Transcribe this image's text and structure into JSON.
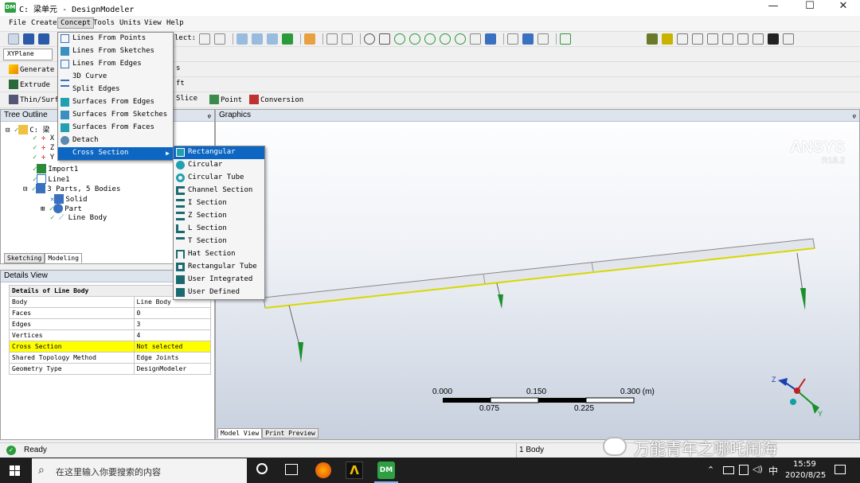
{
  "window": {
    "title": "C: 梁单元 - DesignModeler",
    "minimize": "—",
    "maximize": "☐",
    "close": "✕"
  },
  "menubar": [
    "File",
    "Create",
    "Concept",
    "Tools",
    "Units",
    "View",
    "Help"
  ],
  "toolbar": {
    "select_label": "lect:",
    "plane": "XYPlane",
    "generate": "Generate",
    "extrude": "Extrude",
    "thin": "Thin/Surfa",
    "slice": "Slice",
    "point": "Point",
    "conversion": "Conversion",
    "fragment_s": "s",
    "fragment_ft": "ft"
  },
  "concept_menu": [
    "Lines From Points",
    "Lines From Sketches",
    "Lines From Edges",
    "3D Curve",
    "Split Edges",
    "Surfaces From Edges",
    "Surfaces From Sketches",
    "Surfaces From Faces",
    "Detach",
    "Cross Section"
  ],
  "cross_section_menu": [
    "Rectangular",
    "Circular",
    "Circular Tube",
    "Channel Section",
    "I Section",
    "Z Section",
    "L Section",
    "T Section",
    "Hat Section",
    "Rectangular Tube",
    "User Integrated",
    "User Defined"
  ],
  "tree": {
    "header": "Tree Outline",
    "pin": "ᵩ",
    "root": "C: 梁",
    "nodes": [
      "X",
      "Z",
      "Y",
      "Import1",
      "Line1",
      "3 Parts, 5 Bodies",
      "Solid",
      "Part",
      "Line Body"
    ],
    "tabs": [
      "Sketching",
      "Modeling"
    ]
  },
  "details": {
    "header": "Details View",
    "title": "Details of Line Body",
    "rows": [
      [
        "Body",
        "Line Body"
      ],
      [
        "Faces",
        "0"
      ],
      [
        "Edges",
        "3"
      ],
      [
        "Vertices",
        "4"
      ],
      [
        "Cross Section",
        "Not selected"
      ],
      [
        "Shared Topology Method",
        "Edge Joints"
      ],
      [
        "Geometry Type",
        "DesignModeler"
      ]
    ]
  },
  "graphics": {
    "header": "Graphics",
    "brand": "ANSYS",
    "version": "R18.2",
    "scale_top": [
      "0.000",
      "0.150",
      "0.300 (m)"
    ],
    "scale_bottom": [
      "0.075",
      "0.225"
    ],
    "axis_z": "Z",
    "axis_y": "Y",
    "tabs": [
      "Model View",
      "Print Preview"
    ]
  },
  "status": {
    "ready": "Ready",
    "bodies": "1 Body",
    "watermark": "万能青年之哪吒闹海"
  },
  "taskbar": {
    "search_placeholder": "在这里输入你要搜索的内容",
    "ime": "中",
    "time": "15:59",
    "date": "2020/8/25"
  },
  "colors": {
    "accent": "#0c66c2",
    "highlight": "#ffff00",
    "beam_edge": "#d8d800",
    "load_arrow": "#1a8f2a"
  }
}
